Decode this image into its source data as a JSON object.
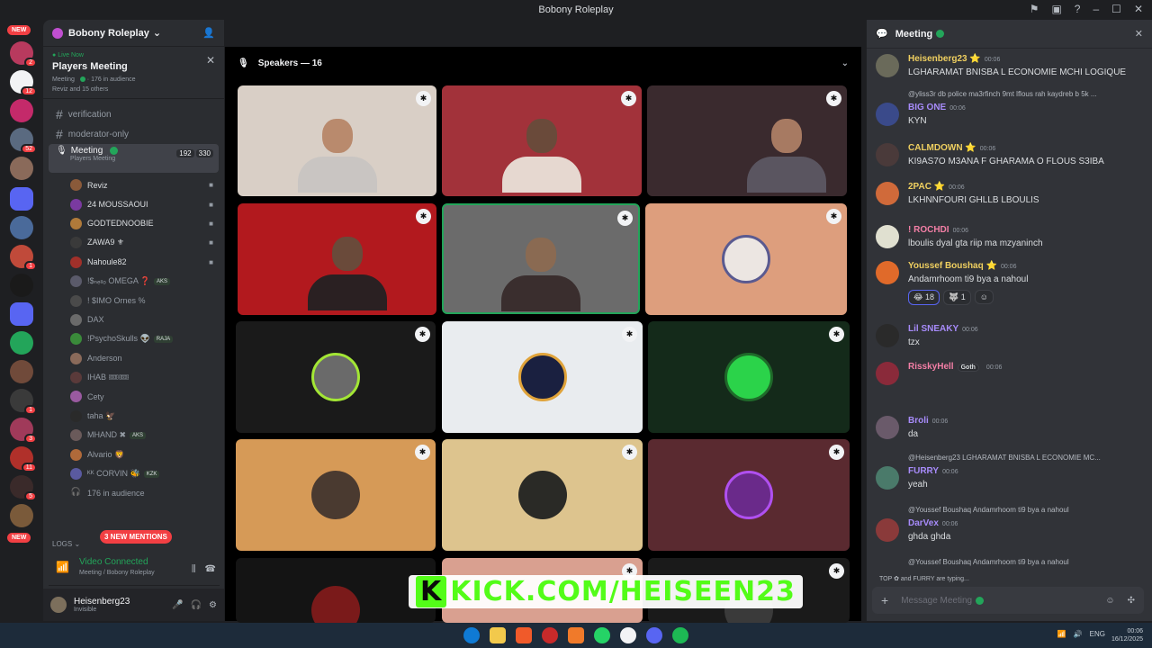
{
  "window": {
    "title": "Bobony Roleplay"
  },
  "servers": {
    "new_label": "NEW",
    "badges": [
      "2",
      "12",
      "52",
      "1",
      "1",
      "3",
      "11",
      "5"
    ]
  },
  "sidebar": {
    "guild_name": "Bobony Roleplay",
    "live": {
      "label": "Live Now",
      "title": "Players Meeting",
      "meta": "Meeting",
      "audience": "176 in audience",
      "others": "Reviz and 15 others"
    },
    "channels": [
      "verification",
      "moderator-only"
    ],
    "meeting": {
      "name": "Meeting",
      "sub": "Players Meeting",
      "count1": "192",
      "count2": "330"
    },
    "users": [
      {
        "name": "Reviz",
        "cam": true
      },
      {
        "name": "24 MOUSSAOUI",
        "cam": true
      },
      {
        "name": "GODTEDNOOBIE",
        "cam": true
      },
      {
        "name": "ZAWA9 ⚜",
        "cam": true
      },
      {
        "name": "Nahoule82",
        "cam": true
      },
      {
        "name": "!$ₙₑₗₗₒ OMEGA ❓",
        "tag": "AKS"
      },
      {
        "name": "! $IMO Ornes %"
      },
      {
        "name": "DAX"
      },
      {
        "name": "!PsychoSkulls 👽",
        "tag": "RAJA"
      },
      {
        "name": "Anderson"
      },
      {
        "name": "IHAB 🎟🎟"
      },
      {
        "name": "Cety"
      },
      {
        "name": "taha 🦅"
      },
      {
        "name": "MHAND ✖",
        "tag": "AKS"
      },
      {
        "name": "Alvario 🦁"
      },
      {
        "name": "ᴷᴷ CORVIN 🐝",
        "tag": "KZK"
      }
    ],
    "audience": "176 in audience",
    "logs": "LOGS",
    "mentions": "3 NEW MENTIONS",
    "voice": {
      "status": "Video Connected",
      "sub": "Meeting  / Bobony Roleplay"
    },
    "me": {
      "name": "Heisenberg23",
      "status": "Invisible"
    }
  },
  "stage": {
    "header": "Speakers — 16",
    "banner": "KICK.COM/HEISEEN23",
    "banner_k": "K"
  },
  "chat": {
    "title": "Meeting",
    "messages": [
      {
        "name": "Heisenberg23 ⭐",
        "time": "00:06",
        "color": "#f0d060",
        "text": "LGHARAMAT BNISBA L ECONOMIE MCHI LOGIQUE"
      },
      {
        "reply": "@yliss3r db police ma3rfinch 9mt lflous rah kaydreb b 5k ...",
        "name": "BIG ONE",
        "time": "00:06",
        "color": "#a78bfa",
        "text": "KYN"
      },
      {
        "name": "CALMDOWN ⭐",
        "time": "00:06",
        "color": "#f0d060",
        "text": "KI9AS7O M3ANA F GHARAMA O FLOUS S3IBA"
      },
      {
        "name": "2PAC ⭐",
        "time": "00:06",
        "color": "#f0d060",
        "text": "LKHNNFOURI GHLLB LBOULIS"
      },
      {
        "name": "! ROCHDI",
        "time": "00:06",
        "color": "#f47fa6",
        "text": "lboulis dyal gta riip ma mzyaninch"
      },
      {
        "name": "Youssef Boushaq ⭐",
        "time": "00:06",
        "color": "#f0d060",
        "text": "Andamrhoom ti9 bya a nahoul",
        "reactions": [
          "😂 18",
          "🐺 1"
        ]
      },
      {
        "name": "Lil SNEAKY",
        "time": "00:06",
        "color": "#a78bfa",
        "text": "tzx"
      },
      {
        "name": "RisskyHell",
        "tag": "Goth",
        "time": "00:06",
        "color": "#f47fa6",
        "text": ""
      },
      {
        "name": "Broli",
        "time": "00:06",
        "color": "#a78bfa",
        "text": "da"
      },
      {
        "reply": "@Heisenberg23 LGHARAMAT BNISBA L ECONOMIE MC...",
        "name": "FURRY",
        "time": "00:06",
        "color": "#a78bfa",
        "text": "yeah"
      },
      {
        "reply": "@Youssef Boushaq Andamrhoom ti9 bya a nahoul",
        "name": "DarVex",
        "time": "00:06",
        "color": "#a78bfa",
        "text": "ghda ghda"
      },
      {
        "reply": "@Youssef Boushaq Andamrhoom ti9 bya a nahoul"
      }
    ],
    "typing": "TOP ✿  and FURRY are typing...",
    "input_placeholder": "Message Meeting"
  },
  "taskbar": {
    "time": "00:06",
    "date": "16/12/2025",
    "lang": "ENG"
  }
}
